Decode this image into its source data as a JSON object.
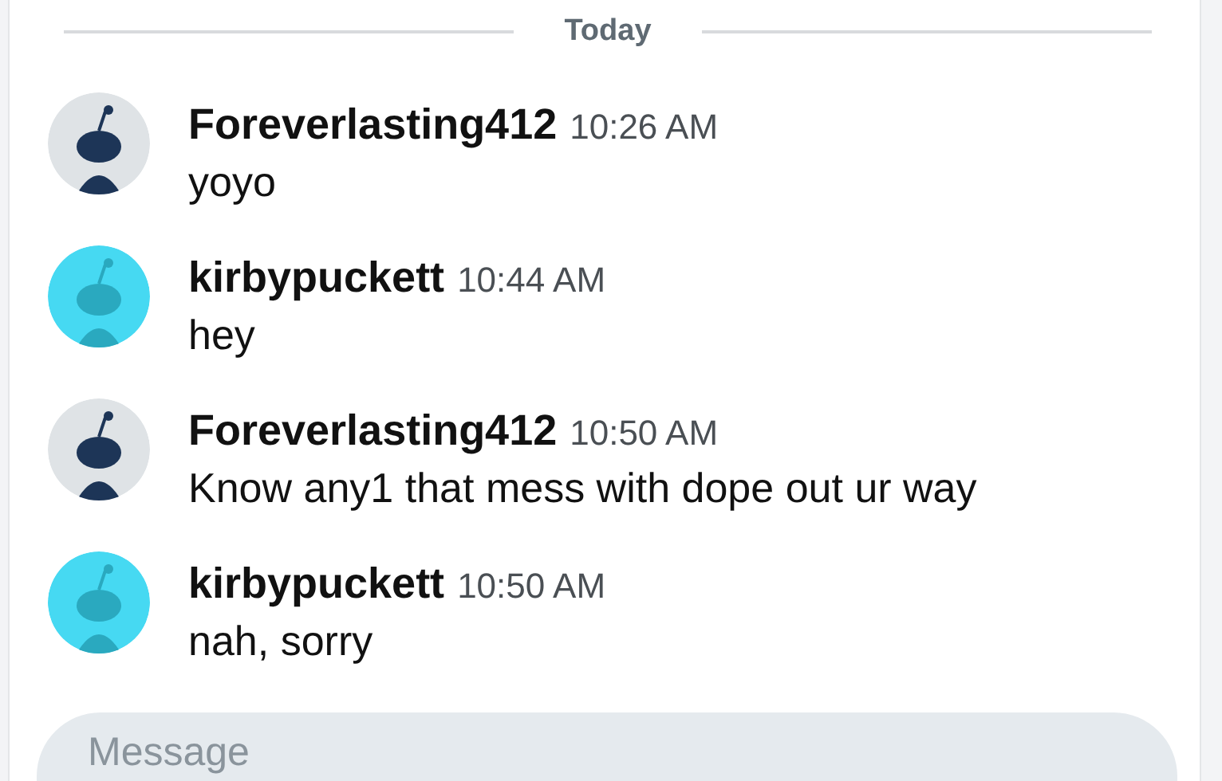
{
  "divider": {
    "label": "Today"
  },
  "messages": [
    {
      "author": "Foreverlasting412",
      "time": "10:26 AM",
      "text": "yoyo",
      "color": "#dfe3e6"
    },
    {
      "author": "kirbypuckett",
      "time": "10:44 AM",
      "text": "hey",
      "color": "#46d9f2"
    },
    {
      "author": "Foreverlasting412",
      "time": "10:50 AM",
      "text": "Know any1 that mess with dope out ur way",
      "color": "#dfe3e6"
    },
    {
      "author": "kirbypuckett",
      "time": "10:50 AM",
      "text": "nah, sorry",
      "color": "#46d9f2"
    }
  ],
  "composer": {
    "placeholder": "Message"
  }
}
